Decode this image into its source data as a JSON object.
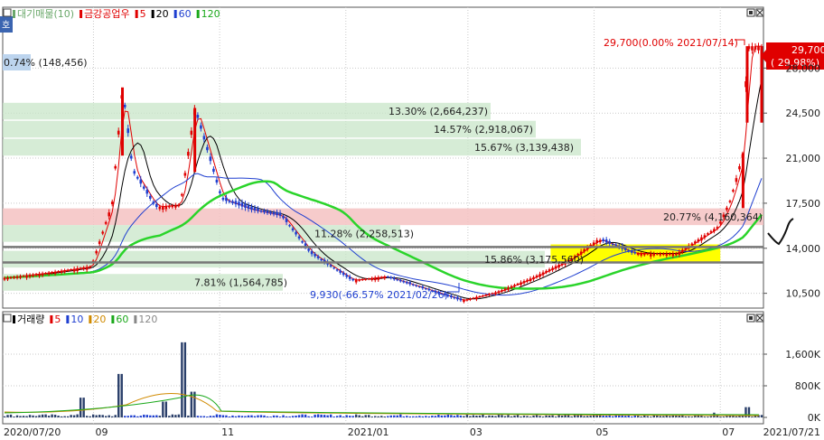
{
  "price_panel": {
    "side_tab": "호",
    "legend": [
      {
        "text": "대기매물(10)",
        "color": "#6aa86a"
      },
      {
        "text": "금강공업우",
        "color": "#e00000"
      },
      {
        "text": "5",
        "color": "#e00000"
      },
      {
        "text": "20",
        "color": "#000000"
      },
      {
        "text": "60",
        "color": "#1f3fd0"
      },
      {
        "text": "120",
        "color": "#1aa81a"
      }
    ],
    "top_label": "0.74% (148,456)",
    "y_ticks": [
      "28,000",
      "24,500",
      "21,000",
      "17,500",
      "14,000",
      "10,500"
    ],
    "last_price": "29,700",
    "last_change": "( 29.98%)",
    "high_annotation": "29,700(0.00% 2021/07/14)",
    "low_annotation": "9,930(-66.57% 2021/02/26)"
  },
  "volume_panel": {
    "legend": [
      {
        "text": "거래량",
        "color": "#000000"
      },
      {
        "text": "5",
        "color": "#e00000"
      },
      {
        "text": "10",
        "color": "#1f3fd0"
      },
      {
        "text": "20",
        "color": "#d08a00"
      },
      {
        "text": "60",
        "color": "#1aa81a"
      },
      {
        "text": "120",
        "color": "#888888"
      }
    ],
    "y_ticks": [
      "1,600K",
      "800K",
      "0K"
    ]
  },
  "x_labels": [
    "2020/07/20",
    "09",
    "11",
    "2021/01",
    "03",
    "05",
    "07",
    "2021/07/21"
  ],
  "colors": {
    "up": "#e00000",
    "down": "#1f3fd0",
    "band": "#c8e6c8",
    "band_hot": "#f5c2c2",
    "highlight": "#ffff00"
  },
  "chart_data": {
    "type": "bar",
    "title": "금강공업우",
    "ylim": [
      9000,
      30500
    ],
    "volume_profile": [
      {
        "pct": "13.30%",
        "volume": "2,664,237",
        "price_from": 24000,
        "price_to": 25300
      },
      {
        "pct": "14.57%",
        "volume": "2,918,067",
        "price_from": 22600,
        "price_to": 23900
      },
      {
        "pct": "15.67%",
        "volume": "3,139,438",
        "price_from": 21200,
        "price_to": 22500
      },
      {
        "pct": "20.77%",
        "volume": "4,160,364",
        "price_from": 15800,
        "price_to": 17100
      },
      {
        "pct": "11.28%",
        "volume": "2,258,513",
        "price_from": 14500,
        "price_to": 15800
      },
      {
        "pct": "15.86%",
        "volume": "3,175,560",
        "price_from": 12500,
        "price_to": 13800
      },
      {
        "pct": "7.81%",
        "volume": "1,564,785",
        "price_from": 10700,
        "price_to": 12000
      },
      {
        "pct": "0.74%",
        "volume": "148,456",
        "price_from": 27300,
        "price_to": 28600
      }
    ],
    "series": [
      {
        "name": "금강공업우",
        "x": [
          "2020/07/20",
          "2020/08/10",
          "2020/08/31",
          "2020/09/10",
          "2020/09/15",
          "2020/09/20",
          "2020/10/01",
          "2020/10/13",
          "2020/10/20",
          "2020/11/02",
          "2020/11/16",
          "2020/12/01",
          "2020/12/15",
          "2021/01/04",
          "2021/01/20",
          "2021/02/01",
          "2021/02/26",
          "2021/03/15",
          "2021/04/01",
          "2021/04/20",
          "2021/05/03",
          "2021/05/20",
          "2021/06/10",
          "2021/06/30",
          "2021/07/06",
          "2021/07/12",
          "2021/07/14",
          "2021/07/21"
        ],
        "values": [
          11700,
          12100,
          12600,
          17500,
          26500,
          20000,
          17200,
          17400,
          24900,
          17800,
          17000,
          16500,
          13600,
          11500,
          11800,
          11200,
          9930,
          10600,
          11700,
          13200,
          14700,
          13600,
          13600,
          15700,
          17800,
          21400,
          29700,
          29700
        ]
      }
    ]
  }
}
